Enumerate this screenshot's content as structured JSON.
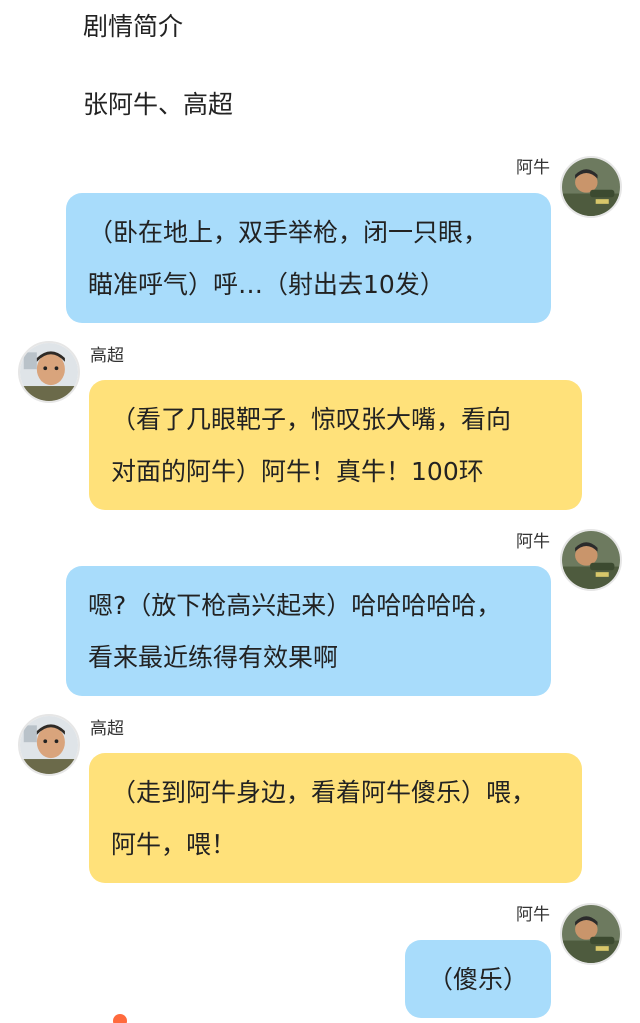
{
  "header": {
    "title": "剧情简介",
    "characters": "张阿牛、高超"
  },
  "messages": [
    {
      "speaker": "阿牛",
      "side": "right",
      "color": "#a8dcfb",
      "lines": [
        "（卧在地上，双手举枪，闭一只眼，",
        "瞄准呼气）呼…（射出去10发）"
      ]
    },
    {
      "speaker": "高超",
      "side": "left",
      "color": "#ffe17a",
      "lines": [
        "（看了几眼靶子，惊叹张大嘴，看向",
        "对面的阿牛）阿牛！真牛！100环"
      ]
    },
    {
      "speaker": "阿牛",
      "side": "right",
      "color": "#a8dcfb",
      "lines": [
        "嗯?（放下枪高兴起来）哈哈哈哈哈，",
        "看来最近练得有效果啊"
      ]
    },
    {
      "speaker": "高超",
      "side": "left",
      "color": "#ffe17a",
      "lines": [
        "（走到阿牛身边，看着阿牛傻乐）喂，",
        "阿牛，喂！"
      ]
    },
    {
      "speaker": "阿牛",
      "side": "right",
      "color": "#a8dcfb",
      "lines": [
        "（傻乐）"
      ]
    }
  ],
  "icons": {
    "aniu_avatar": "aniu-avatar",
    "gaochao_avatar": "gaochao-avatar"
  }
}
